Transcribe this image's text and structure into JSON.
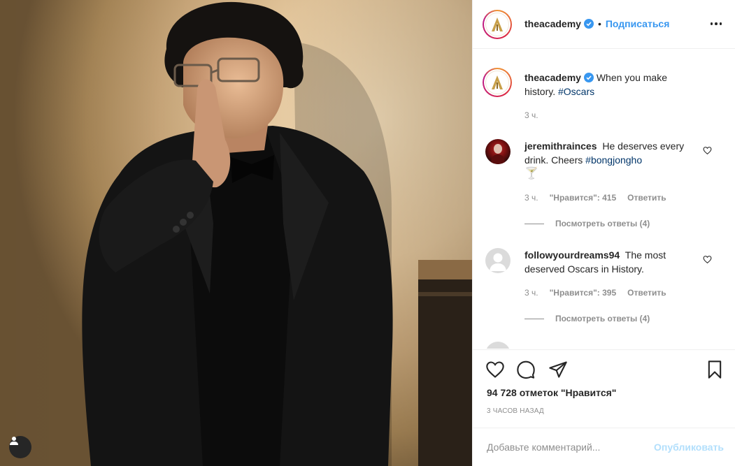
{
  "post": {
    "author": "theacademy",
    "verified": true,
    "follow_label": "Подписаться",
    "separator": "•",
    "caption": "When you make history.",
    "caption_hashtag": "#Oscars",
    "caption_time": "3 ч."
  },
  "comments": [
    {
      "username": "jeremithrainces",
      "text": "He deserves every drink. Cheers",
      "hashtag": "#bongjongho",
      "emoji": "🍸",
      "time": "3 ч.",
      "likes_label": "\"Нравится\": 415",
      "reply_label": "Ответить",
      "view_replies": "Посмотреть ответы (4)"
    },
    {
      "username": "followyourdreams94",
      "text": "The most deserved Oscars in History.",
      "time": "3 ч.",
      "likes_label": "\"Нравится\": 395",
      "reply_label": "Ответить",
      "view_replies": "Посмотреть ответы (4)"
    }
  ],
  "engagement": {
    "likes_text": "94 728 отметок \"Нравится\"",
    "posted_ago": "3 часов назад"
  },
  "composer": {
    "placeholder": "Добавьте комментарий...",
    "publish_label": "Опубликовать"
  },
  "icons": {
    "like": "heart-icon",
    "comment": "comment-icon",
    "share": "paper-plane-icon",
    "save": "bookmark-icon",
    "more": "more-dots-icon",
    "user_tags": "user-tag-icon"
  },
  "colors": {
    "link_blue": "#3897f0",
    "hashtag": "#003569",
    "muted": "#8e8e8e",
    "publish_disabled": "#b2dffc"
  }
}
